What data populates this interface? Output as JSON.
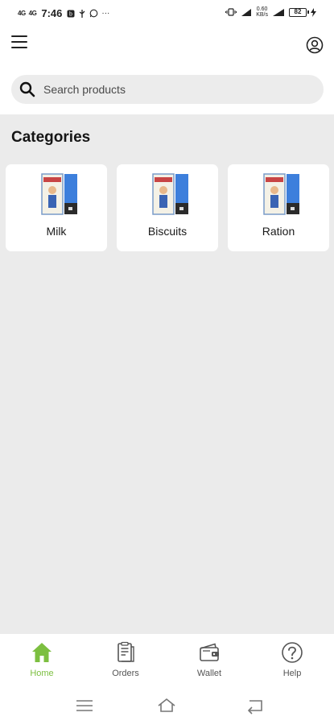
{
  "status_bar": {
    "network_1": "4G",
    "network_2": "4G",
    "time": "7:46",
    "more": "···",
    "speed_value": "0.60",
    "speed_unit": "KB/s",
    "battery": "82"
  },
  "header": {
    "menu_icon": "hamburger-menu-icon",
    "profile_icon": "user-circle-icon"
  },
  "search": {
    "placeholder": "Search products",
    "value": ""
  },
  "categories": {
    "title": "Categories",
    "items": [
      {
        "label": "Milk"
      },
      {
        "label": "Biscuits"
      },
      {
        "label": "Ration"
      }
    ]
  },
  "bottom_nav": {
    "items": [
      {
        "label": "Home",
        "icon": "home-icon",
        "active": true
      },
      {
        "label": "Orders",
        "icon": "orders-icon",
        "active": false
      },
      {
        "label": "Wallet",
        "icon": "wallet-icon",
        "active": false
      },
      {
        "label": "Help",
        "icon": "help-icon",
        "active": false
      }
    ]
  },
  "colors": {
    "accent": "#7cbf40",
    "background": "#ebebeb",
    "card": "#ffffff"
  }
}
